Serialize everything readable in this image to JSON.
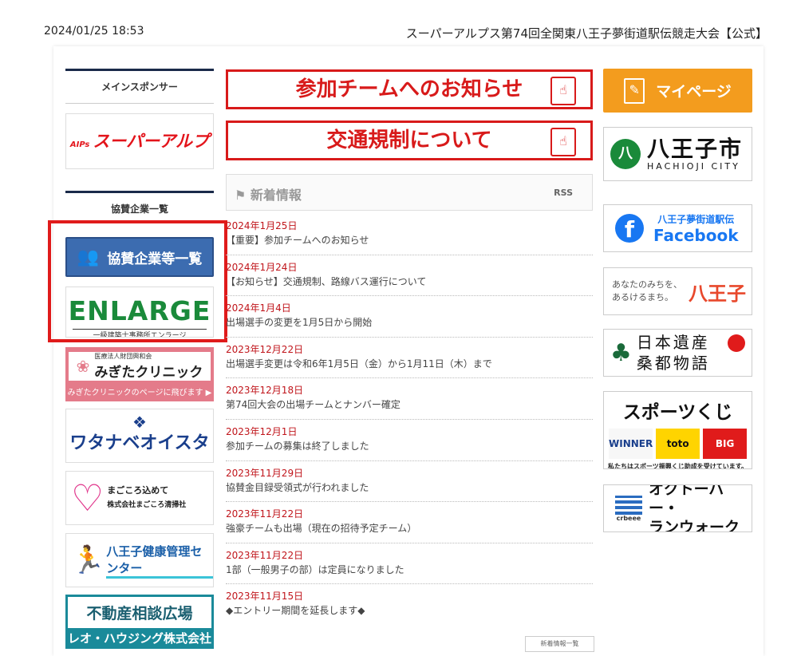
{
  "header": {
    "datetime": "2024/01/25 18:53",
    "site_title": "スーパーアルプス第74回全関東八王子夢街道駅伝競走大会【公式】"
  },
  "left": {
    "main_sponsor_label": "メインスポンサー",
    "alps_mark": "AIPs",
    "alps_name": "スーパーアルプス",
    "sponsors_label": "協賛企業一覧",
    "sponsor_list_button": "協賛企業等一覧",
    "enlarge_title": "ENLARGE",
    "enlarge_sub": "一級建築士事務所エンラージ",
    "migita_corp": "医療法人財団興和会",
    "migita_name": "みぎたクリニック",
    "migita_link": "みぎたクリニックのページに飛びます ▶",
    "watanabe": "ワタナベオイスター",
    "magokoro_line1": "まごころ込めて",
    "magokoro_line2": "株式会社まごころ清掃社",
    "kenko": "八王子健康管理センター",
    "fudosan_line1": "不動産相談広場",
    "fudosan_line2": "レオ・ハウジング株式会社"
  },
  "center": {
    "banner_teams": "参加チームへのお知らせ",
    "banner_traffic": "交通規制について",
    "news_heading": "新着情報",
    "rss": "RSS",
    "news": [
      {
        "date": "2024年1月25日",
        "text": "【重要】参加チームへのお知らせ"
      },
      {
        "date": "2024年1月24日",
        "text": "【お知らせ】交通規制、路線バス運行について"
      },
      {
        "date": "2024年1月4日",
        "text": "出場選手の変更を1月5日から開始"
      },
      {
        "date": "2023年12月22日",
        "text": "出場選手変更は令和6年1月5日（金）から1月11日（木）まで"
      },
      {
        "date": "2023年12月18日",
        "text": "第74回大会の出場チームとナンバー確定"
      },
      {
        "date": "2023年12月1日",
        "text": "参加チームの募集は終了しました"
      },
      {
        "date": "2023年11月29日",
        "text": "協賛金目録受領式が行われました"
      },
      {
        "date": "2023年11月22日",
        "text": "強豪チームも出場（現在の招待予定チーム）"
      },
      {
        "date": "2023年11月22日",
        "text": "1部（一般男子の部）は定員になりました"
      },
      {
        "date": "2023年11月15日",
        "text": "◆エントリー期間を延長します◆"
      }
    ],
    "news_more": "新着情報一覧"
  },
  "right": {
    "mypage": "マイページ",
    "hachioji_jp": "八王子市",
    "hachioji_en": "HACHIOJI CITY",
    "fb_line1": "八王子夢街道駅伝",
    "fb_line2": "Facebook",
    "anata_line1": "あなたのみちを、",
    "anata_line2": "あるけるまち。",
    "anata_city": "八王子",
    "isan_line1": "日本遺産",
    "isan_line2": "桑都物語",
    "sports_title": "スポーツくじ",
    "sports_winner": "WINNER",
    "sports_toto": "toto",
    "sports_big": "BIG",
    "sports_note": "私たちはスポーツ振興くじ助成を受けています。",
    "oct_brand": "crbeee",
    "oct_line1": "オクトーバー・",
    "oct_line2": "ランウォーク"
  },
  "colors": {
    "accent_red": "#d81a1a",
    "mypage_orange": "#f39c1e",
    "date_red": "#c0151b",
    "highlight": "#e01b1b"
  }
}
